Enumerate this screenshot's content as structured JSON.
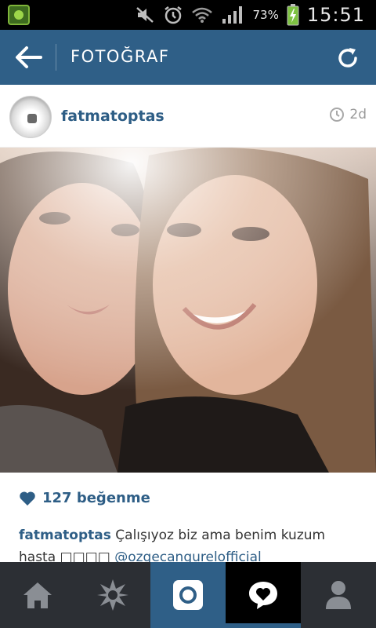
{
  "status_bar": {
    "battery": "73%",
    "time": "15:51"
  },
  "action_bar": {
    "title": "FOTOĞRAF"
  },
  "post": {
    "username": "fatmatoptas",
    "time_ago": "2d",
    "likes": "127 beğenme",
    "caption": {
      "user": "fatmatoptas",
      "text": "Çalışıyoz biz ama benim kuzum hasta □□□□",
      "mention": "@ozgecangurelofficial"
    }
  },
  "tab_bar": {
    "tabs": [
      "home",
      "explore",
      "camera",
      "activity",
      "profile"
    ],
    "active": "activity"
  },
  "colors": {
    "brand": "#2f5f87",
    "link": "#2e5e86",
    "tab_bar": "#2c2f34"
  },
  "icons": {
    "back": "arrow-left-icon",
    "refresh": "refresh-icon",
    "clock": "clock-icon",
    "like": "heart-icon"
  }
}
